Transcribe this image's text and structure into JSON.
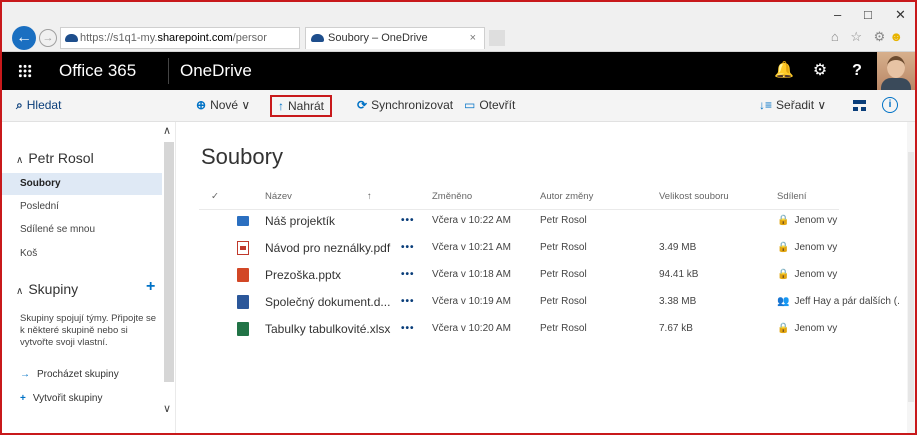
{
  "browser": {
    "url_host": "https://s1q1-my.",
    "url_main": "sharepoint.com",
    "url_rest": "/persor",
    "address_tools": "⌕ ▾ 🔒 ↻",
    "tab_title": "Soubory – OneDrive",
    "tab_close": "×",
    "minimize": "–",
    "maximize": "□",
    "close": "✕",
    "tools_icons": "⌂ ☆ ⚙",
    "smiley": "☻"
  },
  "suite": {
    "brand": "Office 365",
    "app": "OneDrive",
    "bell": "🔔",
    "gear": "⚙",
    "help": "?"
  },
  "commandbar": {
    "search": "Hledat",
    "new_label": "Nové ∨",
    "upload_label": "Nahrát",
    "sync_label": "Synchronizovat",
    "open_label": "Otevřít",
    "sort_label": "Seřadit ∨",
    "sort_icon": "↓≡",
    "info": "i"
  },
  "leftnav": {
    "user": "Petr Rosol",
    "items": [
      {
        "label": "Soubory",
        "selected": true
      },
      {
        "label": "Poslední",
        "selected": false
      },
      {
        "label": "Sdílené se mnou",
        "selected": false
      },
      {
        "label": "Koš",
        "selected": false
      }
    ],
    "groups_title": "Skupiny",
    "groups_desc": "Skupiny spojují týmy. Připojte se k některé skupině nebo si vytvořte svoji vlastní.",
    "browse_groups": "Procházet skupiny",
    "create_group": "Vytvořit skupiny"
  },
  "main": {
    "title": "Soubory",
    "columns": {
      "check": "✓",
      "name": "Název",
      "sort_arrow": "↑",
      "modified": "Změněno",
      "author": "Autor změny",
      "size": "Velikost souboru",
      "sharing": "Sdílení"
    },
    "rows": [
      {
        "name": "Náš projektík",
        "type": "folder",
        "dots": "•••",
        "modified": "Včera v 10:22 AM",
        "author": "Petr Rosol",
        "size": "",
        "share_icon": "🔒",
        "sharing": "Jenom vy"
      },
      {
        "name": "Návod pro neználky.pdf",
        "type": "pdf",
        "dots": "•••",
        "modified": "Včera v 10:21 AM",
        "author": "Petr Rosol",
        "size": "3.49 MB",
        "share_icon": "🔒",
        "sharing": "Jenom vy"
      },
      {
        "name": "Prezoška.pptx",
        "type": "pptx",
        "dots": "•••",
        "modified": "Včera v 10:18 AM",
        "author": "Petr Rosol",
        "size": "94.41 kB",
        "share_icon": "🔒",
        "sharing": "Jenom vy"
      },
      {
        "name": "Společný dokument.d...",
        "type": "docx",
        "dots": "•••",
        "modified": "Včera v 10:19 AM",
        "author": "Petr Rosol",
        "size": "3.38 MB",
        "share_icon": "👥",
        "sharing": "Jeff Hay a pár dalších (."
      },
      {
        "name": "Tabulky tabulkovité.xlsx",
        "type": "xlsx",
        "dots": "•••",
        "modified": "Včera v 10:20 AM",
        "author": "Petr Rosol",
        "size": "7.67 kB",
        "share_icon": "🔒",
        "sharing": "Jenom vy"
      }
    ]
  },
  "colors": {
    "accent": "#0072c6",
    "highlight_border": "#c8191b",
    "suite_bar": "#000000",
    "selected_nav": "#dfe9f5"
  }
}
